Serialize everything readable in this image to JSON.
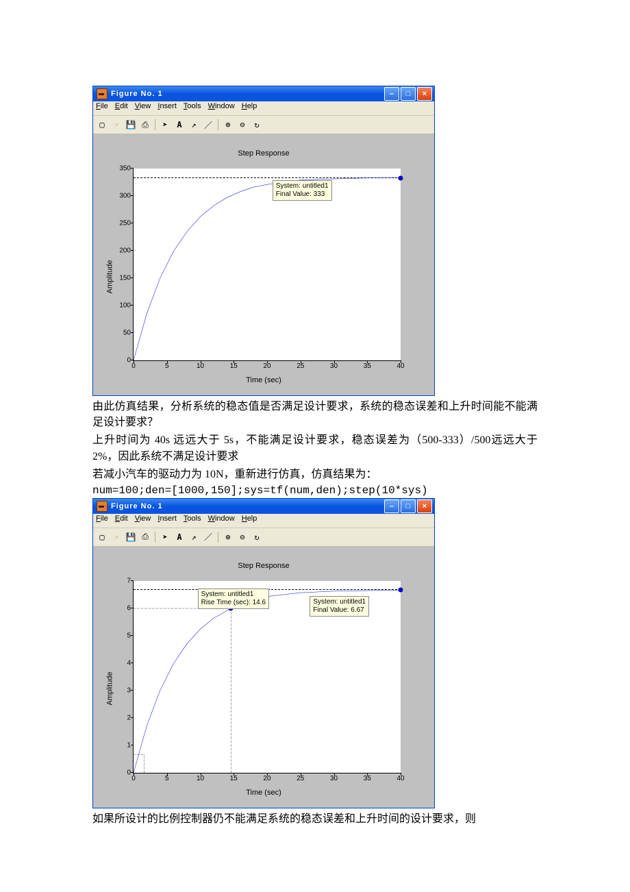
{
  "fig1": {
    "window_title": "Figure No. 1",
    "menus": [
      "File",
      "Edit",
      "View",
      "Insert",
      "Tools",
      "Window",
      "Help"
    ],
    "title": "Step Response",
    "xlabel": "Time (sec)",
    "ylabel": "Amplitude",
    "tip": {
      "line1": "System: untitled1",
      "line2": "Final Value: 333"
    }
  },
  "fig2": {
    "window_title": "Figure No. 1",
    "menus": [
      "File",
      "Edit",
      "View",
      "Insert",
      "Tools",
      "Window",
      "Help"
    ],
    "title": "Step Response",
    "xlabel": "Time (sec)",
    "ylabel": "Amplitude",
    "tip_rise": {
      "line1": "System: untitled1",
      "line2": "Rise Time (sec): 14.6"
    },
    "tip_final": {
      "line1": "System: untitled1",
      "line2": "Final Value: 6.67"
    }
  },
  "text": {
    "p1": "由此仿真结果，分析系统的稳态值是否满足设计要求，系统的稳态误差和上升时间能不能满足设计要求？",
    "p2": "上升时间为 40s 远远大于 5s，不能满足设计要求，稳态误差为（500-333）/500远远大于 2%，因此系统不满足设计要求",
    "p3": "若减小汽车的驱动力为 10N，重新进行仿真，仿真结果为：",
    "code": "num=100;den=[1000,150];sys=tf(num,den);step(10*sys)",
    "p4": "如果所设计的比例控制器仍不能满足系统的稳态误差和上升时间的设计要求，则"
  },
  "chart_data": [
    {
      "type": "line",
      "title": "Step Response",
      "xlabel": "Time (sec)",
      "ylabel": "Amplitude",
      "xlim": [
        0,
        40
      ],
      "ylim": [
        0,
        350
      ],
      "xticks": [
        0,
        5,
        10,
        15,
        20,
        25,
        30,
        35,
        40
      ],
      "yticks": [
        0,
        50,
        100,
        150,
        200,
        250,
        300,
        350
      ],
      "series": [
        {
          "name": "untitled1",
          "final_value": 333,
          "x": [
            0,
            2,
            4,
            6,
            8,
            10,
            12,
            14,
            16,
            18,
            20,
            25,
            30,
            35,
            40
          ],
          "y": [
            0,
            86,
            151,
            199,
            235,
            262,
            282,
            297,
            308,
            316,
            321,
            329,
            331,
            333,
            333
          ]
        }
      ]
    },
    {
      "type": "line",
      "title": "Step Response",
      "xlabel": "Time (sec)",
      "ylabel": "Amplitude",
      "xlim": [
        0,
        40
      ],
      "ylim": [
        0,
        7
      ],
      "xticks": [
        0,
        5,
        10,
        15,
        20,
        25,
        30,
        35,
        40
      ],
      "yticks": [
        0,
        1,
        2,
        3,
        4,
        5,
        6,
        7
      ],
      "series": [
        {
          "name": "untitled1",
          "final_value": 6.67,
          "rise_time_sec": 14.6,
          "x": [
            0,
            2,
            4,
            6,
            8,
            10,
            12,
            14.6,
            16,
            18,
            20,
            25,
            30,
            35,
            40
          ],
          "y": [
            0,
            1.73,
            3.02,
            3.99,
            4.71,
            5.24,
            5.64,
            6.0,
            6.16,
            6.32,
            6.43,
            6.57,
            6.63,
            6.65,
            6.67
          ]
        }
      ]
    }
  ]
}
